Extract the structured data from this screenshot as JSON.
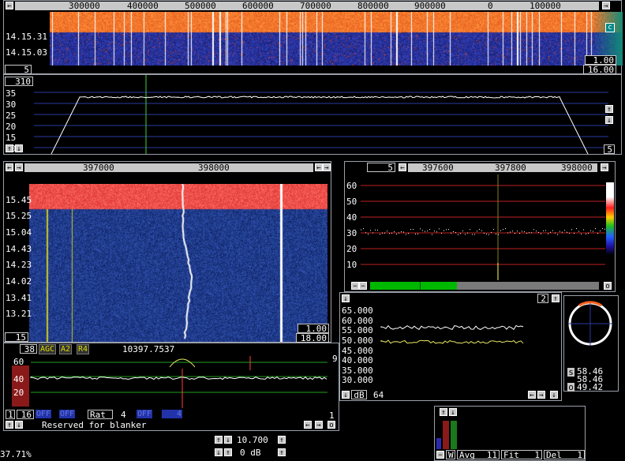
{
  "top_waterfall": {
    "freq_labels": [
      "300000",
      "400000",
      "500000",
      "600000",
      "700000",
      "800000",
      "900000",
      "0",
      "100000"
    ],
    "time_labels": [
      "14.15.31",
      "14.15.03"
    ],
    "left_box": "5",
    "gain_box": "1.00",
    "range_box": "16.00",
    "c_button": "c"
  },
  "top_spectrum": {
    "top_box": "310",
    "y_labels": [
      "35",
      "30",
      "25",
      "20",
      "15",
      "10"
    ],
    "bottom_right": "5"
  },
  "mid_waterfall": {
    "freq_labels": [
      "397000",
      "398000"
    ],
    "time_labels": [
      "15.45",
      "15.25",
      "15.04",
      "14.43",
      "14.23",
      "14.02",
      "13.41",
      "13.21"
    ],
    "gain_box": "1.00",
    "range_box": "18.00",
    "bottom_left": "15"
  },
  "right_spectrum": {
    "left_box": "5",
    "freq_labels": [
      "397600",
      "397800",
      "398000"
    ],
    "y_labels": [
      "60",
      "50",
      "40",
      "30",
      "20",
      "10"
    ],
    "right_button": "o"
  },
  "baseband": {
    "left_box": "38",
    "agc_label": "AGC",
    "a2_label": "A2",
    "r4_label": "R4",
    "frequency": "10397.7537",
    "y_labels": [
      "60",
      "40",
      "20"
    ],
    "right_top": "9",
    "right_bottom": "1",
    "bottom_left": "1",
    "bottom_16": "16",
    "off1": "OFF",
    "off2": "OFF",
    "rat_label": "Rat",
    "rat_value": "4",
    "off3": "OFF",
    "off4": "4",
    "reserved_text": "Reserved for blanker"
  },
  "s_meter": {
    "top_box": "2",
    "y_labels": [
      "65.000",
      "60.000",
      "55.000",
      "50.000",
      "45.000",
      "40.000",
      "35.000",
      "30.000"
    ],
    "db_label": "dB",
    "db_value": "64"
  },
  "polar": {
    "s_value": "58.46",
    "mid_value": "58.46",
    "o_value": "49.42",
    "s_label": "s",
    "o_label": "o"
  },
  "bottom": {
    "freq_value": "10.700",
    "db_value": "0 dB",
    "percent": "37.71%",
    "w_label": "W",
    "avg_label": "Avg",
    "avg_value": "11",
    "fit_label": "Fit",
    "fit_value": "1",
    "del_label": "Del",
    "del_value": "1"
  }
}
